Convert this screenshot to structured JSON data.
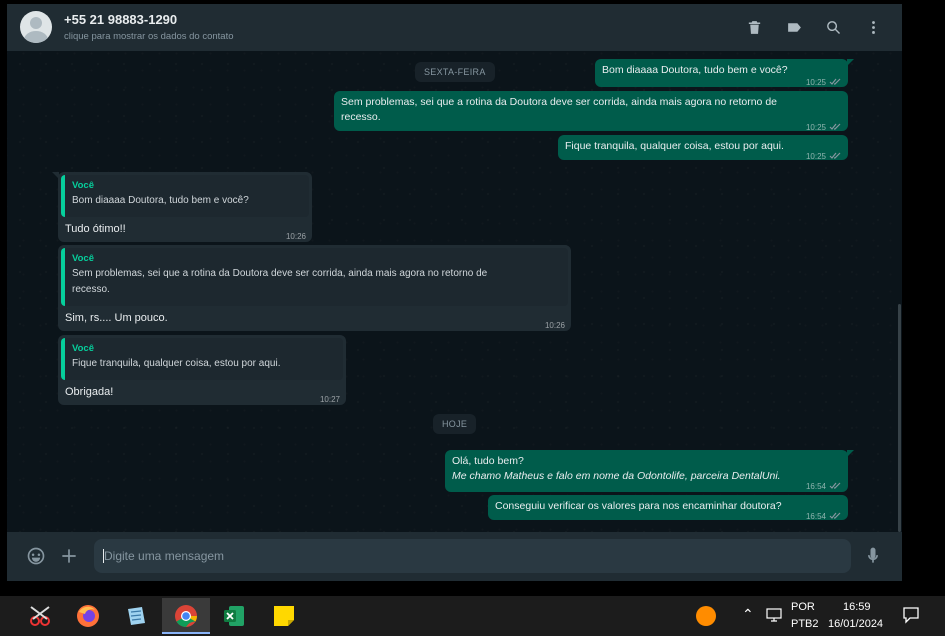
{
  "contact": {
    "name": "+55 21 98883-1290",
    "subtitle": "clique para mostrar os dados do contato"
  },
  "header_icons": [
    "delete-icon",
    "label-icon",
    "search-icon",
    "menu-icon"
  ],
  "day_pills": {
    "friday": "SEXTA-FEIRA",
    "today": "HOJE"
  },
  "messages": [
    {
      "direction": "out",
      "text": "Bom diaaaa Doutora, tudo bem e você?",
      "time": "10:25"
    },
    {
      "direction": "out",
      "text_line1": "Sem problemas, sei que a rotina da Doutora deve ser corrida, ainda mais agora no retorno de",
      "text_line2": "recesso.",
      "time": "10:25"
    },
    {
      "direction": "out",
      "text": "Fique tranquila, qualquer coisa, estou por aqui.",
      "time": "10:25"
    },
    {
      "direction": "in",
      "quote_author": "Você",
      "quote_text": "Bom diaaaa Doutora, tudo bem e você?",
      "text": "Tudo ótimo!!",
      "time": "10:26"
    },
    {
      "direction": "in",
      "quote_author": "Você",
      "quote_line1": "Sem problemas, sei que a rotina da Doutora deve ser corrida, ainda mais agora no retorno de",
      "quote_line2": "recesso.",
      "text": "Sim, rs.... Um pouco.",
      "time": "10:26"
    },
    {
      "direction": "in",
      "quote_author": "Você",
      "quote_text": "Fique tranquila, qualquer coisa, estou por aqui.",
      "text": "Obrigada!",
      "time": "10:27"
    },
    {
      "direction": "out",
      "text_line1": "Olá, tudo bem?",
      "text_line2": "Me chamo Matheus e falo em nome da Odontolife, parceira DentalUni.",
      "time": "16:54"
    },
    {
      "direction": "out",
      "text": "Conseguiu verificar os valores para nos encaminhar doutora?",
      "time": "16:54"
    }
  ],
  "composer": {
    "placeholder": "Digite uma mensagem"
  },
  "taskbar": {
    "apps": [
      "snipping-tool-icon",
      "firefox-icon",
      "notepad-icon",
      "chrome-icon",
      "excel-icon",
      "sticky-notes-icon"
    ],
    "language": "POR",
    "keyboard": "PTB2",
    "time": "16:59",
    "date": "16/01/2024"
  },
  "colors": {
    "outgoing": "#005c4b",
    "incoming": "#202c33",
    "accent": "#06cf9c",
    "background": "#0b141a"
  }
}
